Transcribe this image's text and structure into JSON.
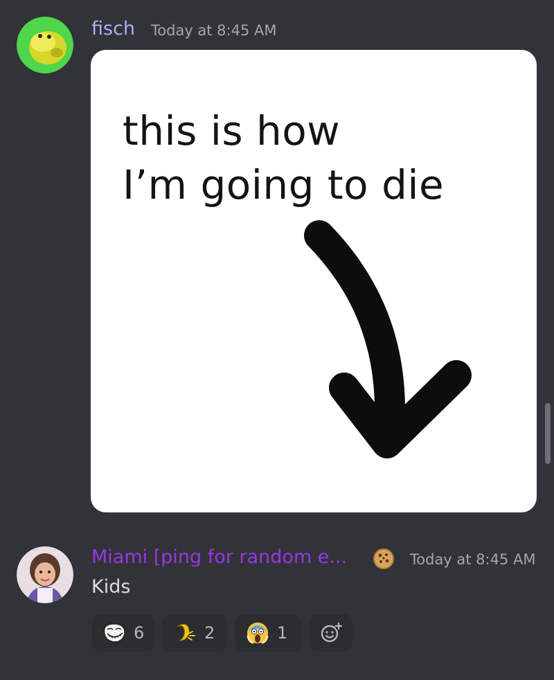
{
  "messages": [
    {
      "author": "fisch",
      "author_color": "#a7b0f6",
      "timestamp": "Today at 8:45 AM",
      "avatar_icon": "yellow-blob-avatar",
      "attachment": {
        "line1": "this is how",
        "line2": "I’m going to die",
        "arrow_icon": "arrow-down-right-icon"
      }
    },
    {
      "author": "Miami [ping for random e...",
      "author_color": "#9b34e4",
      "badge_icon": "cookie-icon",
      "timestamp": "Today at 8:45 AM",
      "avatar_icon": "child-photo-avatar",
      "text": "Kids",
      "reactions": [
        {
          "emoji": "trollface",
          "count": "6"
        },
        {
          "emoji": "banana",
          "count": "2"
        },
        {
          "emoji": "screaming-face",
          "count": "1"
        }
      ],
      "add_reaction_icon": "add-reaction-icon"
    }
  ]
}
